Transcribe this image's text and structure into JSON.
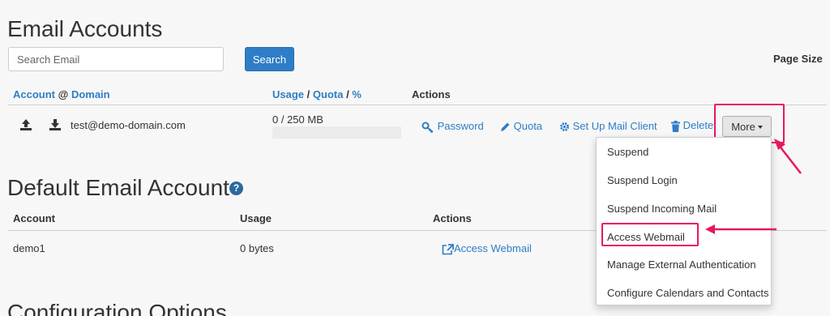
{
  "email_accounts": {
    "title": "Email Accounts",
    "search_placeholder": "Search Email",
    "search_button": "Search",
    "page_size_label": "Page Size",
    "headers": {
      "account": "Account",
      "at": "@",
      "domain": "Domain",
      "usage": "Usage",
      "slash1": "/",
      "quota": "Quota",
      "slash2": "/",
      "percent": "%",
      "actions": "Actions"
    },
    "row": {
      "email": "test@demo-domain.com",
      "usage": "0 / 250 MB",
      "usage_fraction": 0
    },
    "actions": {
      "password": "Password",
      "quota": "Quota",
      "setup_mail_client": "Set Up Mail Client",
      "delete": "Delete",
      "more": "More"
    }
  },
  "more_menu": {
    "items": [
      "Suspend",
      "Suspend Login",
      "Suspend Incoming Mail",
      "Access Webmail",
      "Manage External Authentication",
      "Configure Calendars and Contacts"
    ]
  },
  "default_email_account": {
    "title": "Default Email Account",
    "help_icon": "?",
    "headers": {
      "account": "Account",
      "usage": "Usage",
      "actions": "Actions"
    },
    "row": {
      "account": "demo1",
      "usage": "0 bytes",
      "action": "Access Webmail"
    }
  },
  "configuration_options": {
    "title": "Configuration Options"
  },
  "colors": {
    "link": "#2f7dc6",
    "primary_button": "#2f7dc6",
    "highlight": "#e8175d"
  }
}
